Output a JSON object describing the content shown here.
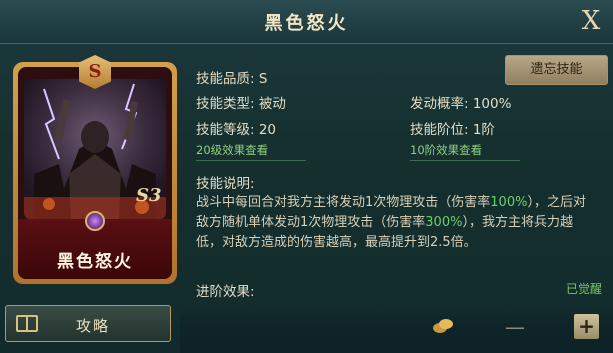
{
  "dialog": {
    "title": "黑色怒火",
    "close_glyph": "X"
  },
  "card": {
    "grade_letter": "S",
    "name": "黑色怒火",
    "level_mark": "S3"
  },
  "actions": {
    "forget_skill": "遗忘技能",
    "guide": "攻略"
  },
  "attributes": {
    "quality": "技能品质: S",
    "type": "技能类型: 被动",
    "level": "技能等级: 20",
    "trigger_rate": "发动概率: 100%",
    "rank": "技能阶位: 1阶",
    "view_level_effect": "20级效果查看",
    "view_rank_effect": "10阶效果查看"
  },
  "description": {
    "heading": "技能说明:",
    "part1": "战斗中每回合对我方主将发动1次物理攻击（伤害率",
    "hl1": "100%",
    "part2": "），之后对敌方随机单体发动1次物理攻击（伤害率",
    "hl2": "300%",
    "part3": "），我方主将兵力越低，对敌方造成的伤害越高，最高提升到2.5倍。"
  },
  "advanced": {
    "heading": "进阶效果:",
    "status": "已觉醒"
  },
  "footer": {
    "minus": "—",
    "plus": "+"
  },
  "colors": {
    "highlight": "#66d26a",
    "link": "#8fd07e",
    "card_frame": "#d2a14c"
  }
}
